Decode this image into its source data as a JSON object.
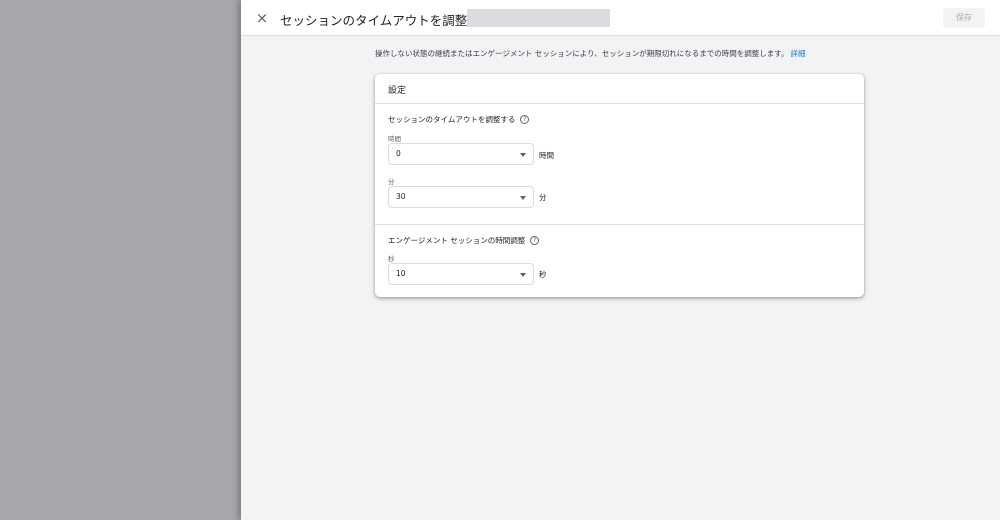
{
  "header": {
    "title": "セッションのタイムアウトを調整する",
    "save_label": "保存",
    "close_icon": "×"
  },
  "description": {
    "text": "操作しない状態の継続またはエンゲージメント セッションにより、セッションが期限切れになるまでの時間を調整します。",
    "link": "詳細"
  },
  "card": {
    "title": "設定",
    "session_timeout": {
      "title": "セッションのタイムアウトを調整する",
      "help_icon": "?",
      "hours": {
        "label": "時間",
        "value": "0",
        "unit": "時間"
      },
      "minutes": {
        "label": "分",
        "value": "30",
        "unit": "分"
      }
    },
    "engaged_session": {
      "title": "エンゲージメント セッションの時間調整",
      "help_icon": "?",
      "seconds": {
        "label": "秒",
        "value": "10",
        "unit": "秒"
      }
    }
  }
}
